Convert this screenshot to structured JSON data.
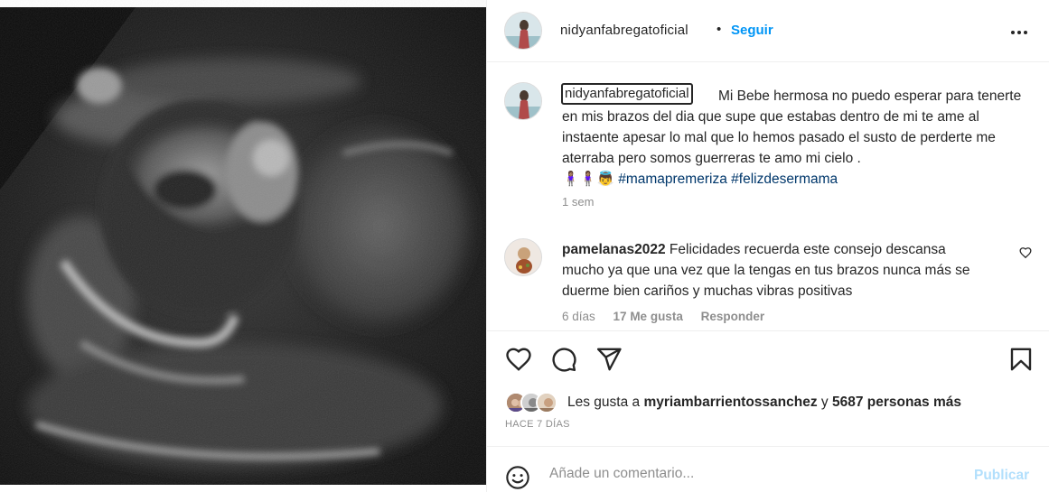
{
  "post": {
    "username": "nidyanfabregatoficial",
    "follow_label": "Seguir",
    "more_icon": "more-horizontal-icon",
    "separator": "•"
  },
  "caption": {
    "username": "nidyanfabregatoficial",
    "text_line1": "Mi Bebe hermosa no puedo esperar para",
    "text_rest": "tenerte en mis brazos del dia que supe que estabas dentro de mi te ame al instaente apesar lo mal que lo hemos pasado el susto de perderte me aterraba pero somos guerreras te amo mi cielo .",
    "emojis": "🧍🏽‍♀️🧍🏽‍♀️👼",
    "hashtag1": "#mamapremeriza",
    "hashtag2": "#felizdesermama",
    "time": "1 sem"
  },
  "comment": {
    "username": "pamelanas2022",
    "text": "Felicidades recuerda este consejo descansa mucho ya que una vez que la tengas en tus brazos nunca más se duerme bien cariños y muchas vibras positivas",
    "time": "6 días",
    "likes": "17 Me gusta",
    "reply_label": "Responder"
  },
  "likes": {
    "prefix": "Les gusta a",
    "user": "myriambarrientossanchez",
    "conj": "y",
    "others": "5687 personas más"
  },
  "date": "HACE 7 DÍAS",
  "add_comment": {
    "placeholder": "Añade un comentario...",
    "publish_label": "Publicar"
  },
  "colors": {
    "link_blue": "#0095f6",
    "hashtag": "#00376b",
    "muted": "#8e8e8e",
    "publish_disabled": "#b2dffc"
  }
}
